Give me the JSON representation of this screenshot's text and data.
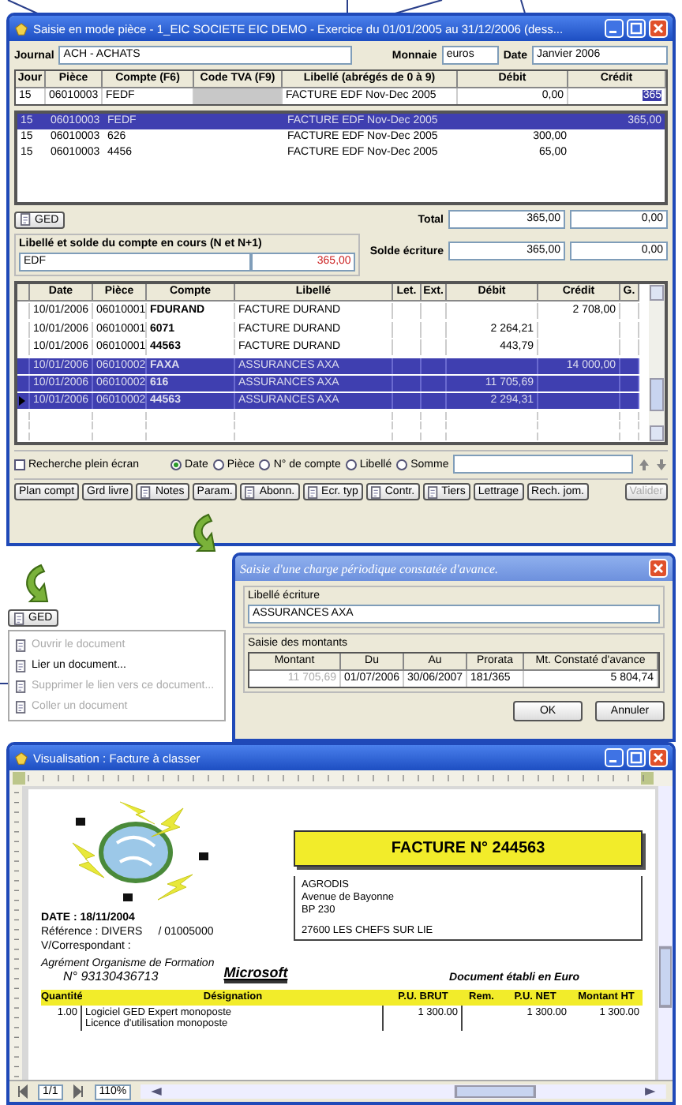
{
  "main_window": {
    "title": "Saisie en mode pièce - 1_EIC SOCIETE EIC DEMO - Exercice du 01/01/2005 au 31/12/2006 (dess...",
    "journal_label": "Journal",
    "journal": "ACH - ACHATS",
    "monnaie_label": "Monnaie",
    "monnaie": "euros",
    "date_label": "Date",
    "date": "Janvier 2006",
    "entry_columns": [
      "Jour",
      "Pièce",
      "Compte (F6)",
      "Code TVA (F9)",
      "Libellé (abrégés de 0 à 9)",
      "Débit",
      "Crédit"
    ],
    "entry_row": {
      "jour": "15",
      "piece": "06010003",
      "compte": "FEDF",
      "libelle": "FACTURE EDF Nov-Dec 2005",
      "debit": "0,00",
      "credit": "365"
    },
    "lines": [
      {
        "jour": "15",
        "piece": "06010003",
        "compte": "FEDF",
        "libelle": "FACTURE EDF Nov-Dec 2005",
        "credit": "365,00",
        "selected": true
      },
      {
        "jour": "15",
        "piece": "06010003",
        "compte": "626",
        "libelle": "FACTURE EDF Nov-Dec 2005",
        "debit": "300,00",
        "selected": false
      },
      {
        "jour": "15",
        "piece": "06010003",
        "compte": "4456",
        "libelle": "FACTURE EDF Nov-Dec 2005",
        "debit": "65,00",
        "selected": false
      }
    ],
    "ged_button": "GED",
    "total_label": "Total",
    "total_debit": "365,00",
    "total_credit": "0,00",
    "account_label": "Libellé et solde du compte en cours (N et N+1)",
    "account_name": "EDF",
    "account_balance": "365,00",
    "solde_label": "Solde écriture",
    "solde_debit": "365,00",
    "solde_credit": "0,00",
    "grid_columns": [
      "Date",
      "Pièce",
      "Compte",
      "Libellé",
      "Let.",
      "Ext.",
      "Débit",
      "Crédit",
      "G."
    ],
    "grid_rows": [
      {
        "date": "10/01/2006",
        "piece": "06010001",
        "compte": "FDURAND",
        "libelle": "FACTURE DURAND",
        "credit": "2 708,00",
        "selected": false,
        "current": false
      },
      {
        "date": "10/01/2006",
        "piece": "06010001",
        "compte": "6071",
        "libelle": "FACTURE DURAND",
        "debit": "2 264,21",
        "selected": false,
        "current": false
      },
      {
        "date": "10/01/2006",
        "piece": "06010001",
        "compte": "44563",
        "libelle": "FACTURE DURAND",
        "debit": "443,79",
        "selected": false,
        "current": false
      },
      {
        "date": "10/01/2006",
        "piece": "06010002",
        "compte": "FAXA",
        "libelle": "ASSURANCES AXA",
        "credit": "14 000,00",
        "selected": true,
        "current": false
      },
      {
        "date": "10/01/2006",
        "piece": "06010002",
        "compte": "616",
        "libelle": "ASSURANCES AXA",
        "debit": "11 705,69",
        "selected": true,
        "current": false
      },
      {
        "date": "10/01/2006",
        "piece": "06010002",
        "compte": "44563",
        "libelle": "ASSURANCES AXA",
        "debit": "2 294,31",
        "selected": true,
        "current": true
      }
    ],
    "fullscreen_label": "Recherche plein écran",
    "fullscreen_checked": false,
    "sort_options": [
      {
        "label": "Date",
        "selected": true
      },
      {
        "label": "Pièce",
        "selected": false
      },
      {
        "label": "N° de compte",
        "selected": false
      },
      {
        "label": "Libellé",
        "selected": false
      },
      {
        "label": "Somme",
        "selected": false
      }
    ],
    "toolbar": [
      {
        "label": "Plan compt",
        "kind": "plain"
      },
      {
        "label": "Grd livre",
        "kind": "plain"
      },
      {
        "label": "Notes",
        "kind": "icon"
      },
      {
        "label": "Param.",
        "kind": "plain"
      },
      {
        "label": "Abonn.",
        "kind": "icon"
      },
      {
        "label": "Ecr. typ",
        "kind": "icon"
      },
      {
        "label": "Contr.",
        "kind": "icon"
      },
      {
        "label": "Tiers",
        "kind": "icon"
      },
      {
        "label": "Lettrage",
        "kind": "plain"
      },
      {
        "label": "Rech. jom.",
        "kind": "plain"
      }
    ],
    "validate_button": {
      "label": "Valider",
      "disabled": true
    }
  },
  "ged_menu": {
    "button": "GED",
    "items": [
      {
        "label": "Ouvrir le document",
        "disabled": true
      },
      {
        "label": "Lier un document...",
        "disabled": false
      },
      {
        "label": "Supprimer le lien vers ce document...",
        "disabled": true
      },
      {
        "label": "Coller un document",
        "disabled": true
      }
    ]
  },
  "dialog": {
    "title": "Saisie d'une charge périodique constatée d'avance.",
    "label_section": "Libellé écriture",
    "label_value": "ASSURANCES AXA",
    "amounts_section": "Saisie des montants",
    "columns": [
      "Montant",
      "Du",
      "Au",
      "Prorata",
      "Mt. Constaté d'avance"
    ],
    "row": [
      "11 705,69",
      "01/07/2006",
      "30/06/2007",
      "181/365",
      "5 804,74"
    ],
    "buttons": [
      "OK",
      "Annuler"
    ]
  },
  "viewer": {
    "title": "Visualisation : Facture à classer",
    "invoice_title": "FACTURE N° 244563",
    "address": [
      "AGRODIS",
      "Avenue de Bayonne",
      "BP 230",
      "27600   LES CHEFS SUR LIE"
    ],
    "date_line": "DATE : 18/11/2004",
    "reference": "Référence :  DIVERS",
    "reference_number": "/ 01005000",
    "correspondent": "V/Correspondant :",
    "agreement": "Agrément Organisme de Formation",
    "agreement_number": "N° 93130436713",
    "partner_logo": "Microsoft",
    "currency_note": "Document établi en Euro",
    "columns": [
      "Quantité",
      "Désignation",
      "P.U. BRUT",
      "Rem.",
      "P.U. NET",
      "Montant HT"
    ],
    "line": {
      "quantity": "1.00",
      "designation": [
        "Logiciel GED Expert monoposte",
        "Licence d'utilisation monoposte"
      ],
      "unit_gross": "1 300.00",
      "unit_net": "1 300.00",
      "amount": "1 300.00"
    },
    "page": "1/1",
    "zoom": "110%"
  }
}
